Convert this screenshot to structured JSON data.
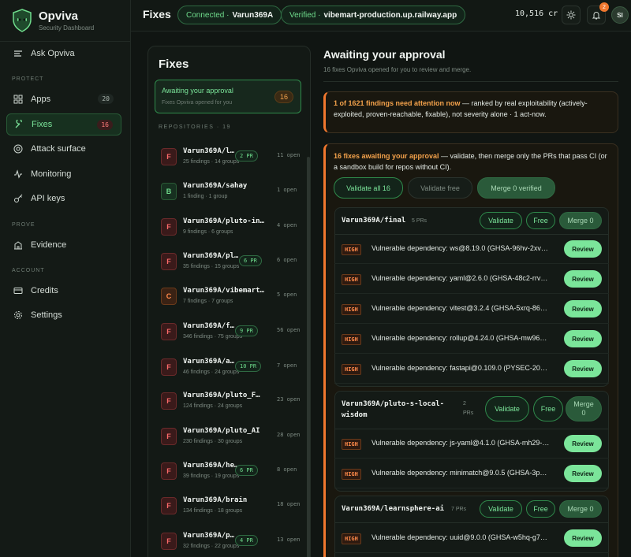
{
  "brand": {
    "name": "Opviva",
    "subtitle": "Security Dashboard"
  },
  "sidebar": {
    "ask": "Ask Opviva",
    "sections": {
      "protect": "PROTECT",
      "prove": "PROVE",
      "account": "ACCOUNT"
    },
    "items": {
      "apps": {
        "label": "Apps",
        "count": "20"
      },
      "fixes": {
        "label": "Fixes",
        "count": "16"
      },
      "attack_surface": {
        "label": "Attack surface"
      },
      "monitoring": {
        "label": "Monitoring"
      },
      "api_keys": {
        "label": "API keys"
      },
      "evidence": {
        "label": "Evidence"
      },
      "credits": {
        "label": "Credits"
      },
      "settings": {
        "label": "Settings"
      }
    }
  },
  "header": {
    "title": "Fixes",
    "connected_label": "Connected ·",
    "connected_user": "Varun369A",
    "verified_label": "Verified ·",
    "verified_domain": "vibemart-production.up.railway.app",
    "credits": "10,516 cr",
    "notifications": "2",
    "avatar_initials": "SI"
  },
  "fixes_panel": {
    "title": "Fixes",
    "awaiting": {
      "title": "Awaiting your approval",
      "subtitle": "Fixes Opviva opened for you",
      "count": "16"
    },
    "repos_label": "REPOSITORIES · 19",
    "repos": [
      {
        "letter": "F",
        "variant": "f",
        "name": "Varun369A/l…",
        "meta": "25 findings · 14 groups",
        "pr": "2 PR",
        "open": "11 open"
      },
      {
        "letter": "B",
        "variant": "b",
        "name": "Varun369A/sahay",
        "meta": "1 finding · 1 group",
        "pr": "",
        "open": "1 open"
      },
      {
        "letter": "F",
        "variant": "f",
        "name": "Varun369A/pluto-in…",
        "meta": "9 findings · 6 groups",
        "pr": "",
        "open": "4 open"
      },
      {
        "letter": "F",
        "variant": "f",
        "name": "Varun369A/pl…",
        "meta": "35 findings · 15 groups",
        "pr": "6 PR",
        "open": "6 open"
      },
      {
        "letter": "C",
        "variant": "c",
        "name": "Varun369A/vibemart…",
        "meta": "7 findings · 7 groups",
        "pr": "",
        "open": "5 open"
      },
      {
        "letter": "F",
        "variant": "f",
        "name": "Varun369A/f…",
        "meta": "346 findings · 75 groups",
        "pr": "9 PR",
        "open": "56 open"
      },
      {
        "letter": "F",
        "variant": "f",
        "name": "Varun369A/a…",
        "meta": "46 findings · 24 groups",
        "pr": "10 PR",
        "open": "7 open"
      },
      {
        "letter": "F",
        "variant": "f",
        "name": "Varun369A/pluto_F…",
        "meta": "124 findings · 24 groups",
        "pr": "",
        "open": "23 open"
      },
      {
        "letter": "F",
        "variant": "f",
        "name": "Varun369A/pluto_AI",
        "meta": "230 findings · 30 groups",
        "pr": "",
        "open": "28 open"
      },
      {
        "letter": "F",
        "variant": "f",
        "name": "Varun369A/he…",
        "meta": "39 findings · 19 groups",
        "pr": "6 PR",
        "open": "8 open"
      },
      {
        "letter": "F",
        "variant": "f",
        "name": "Varun369A/brain",
        "meta": "134 findings · 18 groups",
        "pr": "",
        "open": "18 open"
      },
      {
        "letter": "F",
        "variant": "f",
        "name": "Varun369A/p…",
        "meta": "32 findings · 22 groups",
        "pr": "4 PR",
        "open": "13 open"
      }
    ]
  },
  "approval": {
    "title": "Awaiting your approval",
    "subtitle": "16 fixes Opviva opened for you to review and merge.",
    "alert1_highlight": "1 of 1621 findings need attention now",
    "alert1_text": " — ranked by real exploitability (actively-exploited, proven-reachable, fixable), not severity alone · 1 act-now.",
    "alert2_highlight": "16 fixes awaiting your approval",
    "alert2_text": " — validate, then merge only the PRs that pass CI (or a sandbox build for repos without CI).",
    "validate_all": "Validate all 16",
    "validate_free": "Validate free",
    "merge_verified": "Merge 0 verified",
    "groups": [
      {
        "name": "Varun369A/final",
        "prs": "5 PRs",
        "validate": "Validate",
        "free": "Free",
        "merge": "Merge 0",
        "fixes": [
          {
            "sev": "HIGH",
            "text": "Vulnerable dependency: ws@8.19.0 (GHSA-96hv-2xv…",
            "action": "Review"
          },
          {
            "sev": "HIGH",
            "text": "Vulnerable dependency: yaml@2.6.0 (GHSA-48c2-rrv…",
            "action": "Review"
          },
          {
            "sev": "HIGH",
            "text": "Vulnerable dependency: vitest@3.2.4 (GHSA-5xrq-86…",
            "action": "Review"
          },
          {
            "sev": "HIGH",
            "text": "Vulnerable dependency: rollup@4.24.0 (GHSA-mw96…",
            "action": "Review"
          },
          {
            "sev": "HIGH",
            "text": "Vulnerable dependency: fastapi@0.109.0 (PYSEC-20…",
            "action": "Review"
          }
        ]
      },
      {
        "name_line1": "Varun369A/pluto-s-local-",
        "name_line2": "wisdom",
        "prs_line1": "2",
        "prs_line2": "PRs",
        "validate": "Validate",
        "free": "Free",
        "merge_line1": "Merge",
        "merge_line2": "0",
        "fixes": [
          {
            "sev": "HIGH",
            "text": "Vulnerable dependency: js-yaml@4.1.0 (GHSA-mh29-…",
            "action": "Review"
          },
          {
            "sev": "HIGH",
            "text": "Vulnerable dependency: minimatch@9.0.5 (GHSA-3p…",
            "action": "Review"
          }
        ]
      },
      {
        "name": "Varun369A/learnsphere-ai",
        "prs": "7 PRs",
        "validate": "Validate",
        "free": "Free",
        "merge": "Merge 0",
        "fixes": [
          {
            "sev": "HIGH",
            "text": "Vulnerable dependency: uuid@9.0.0 (GHSA-w5hq-g7…",
            "action": "Review"
          }
        ]
      }
    ]
  },
  "colors": {
    "accent": "#7be59a",
    "warning": "#f0772e",
    "danger": "#ff6b6b",
    "background": "#101512"
  }
}
